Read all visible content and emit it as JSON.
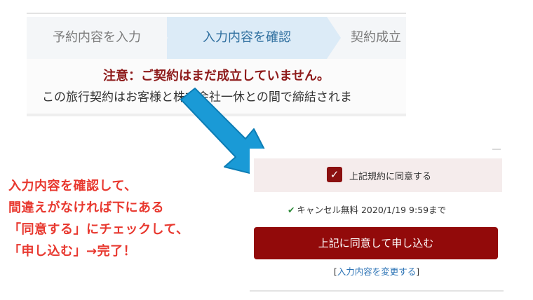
{
  "steps": {
    "step1": "予約内容を入力",
    "step2": "入力内容を確認",
    "step3": "契約成立"
  },
  "notice": {
    "title": "注意：ご契約はまだ成立していません。",
    "body": "この旅行契約はお客様と株式会社一休との間で締結されま"
  },
  "form": {
    "agree_label": "上記規約に同意する",
    "cancel_free": "キャンセル無料 2020/1/19 9:59まで",
    "submit_label": "上記に同意して申し込む",
    "change_bracket_open": "[",
    "change_link": "入力内容を変更する",
    "change_bracket_close": "]"
  },
  "annotation": {
    "lines": [
      "入力内容を確認して、",
      "間違えがなければ下にある",
      "「同意する」にチェックして、",
      "「申し込む」→完了！"
    ]
  },
  "colors": {
    "accent": "#920a0a",
    "step_active_bg": "#dcebf7",
    "annotation": "#e8382f",
    "arrow": "#1a9ad6"
  }
}
